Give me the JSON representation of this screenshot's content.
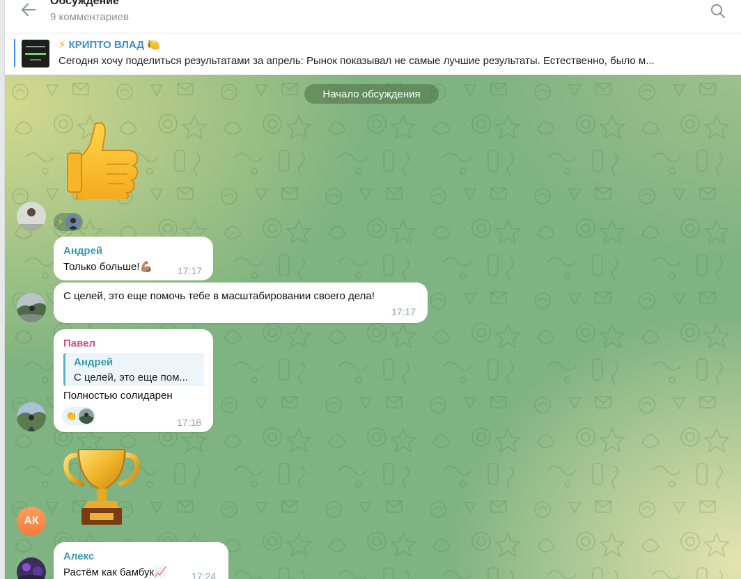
{
  "header": {
    "title": "Обсуждение",
    "subtitle": "9 комментариев"
  },
  "pinned_post": {
    "channel_name": "КРИПТО ВЛАД",
    "name_prefix_emoji": "⚡",
    "name_suffix_emoji": "🍋",
    "preview_text": "Сегодня хочу поделиться результатами за апрель:   Рынок показывал не самые лучшие результаты. Естественно, было м..."
  },
  "chat": {
    "date_separator": "Начало обсуждения",
    "messages": [
      {
        "type": "sticker",
        "sticker": "thumbs-up",
        "reactions": [
          {
            "emoji": "⚡",
            "count_avatars": 1
          }
        ]
      },
      {
        "type": "text",
        "sender": "Андрей",
        "sender_color": "#3a9ab0",
        "text": "Только больше!💪🏽",
        "time": "17:17"
      },
      {
        "type": "text",
        "sender": "",
        "text": "С целей, это еще помочь тебе в масштабировании своего дела!",
        "time": "17:17"
      },
      {
        "type": "reply",
        "sender": "Павел",
        "sender_color": "#d04f8a",
        "reply_to_sender": "Андрей",
        "reply_to_text": "С целей, это еще пом...",
        "text": "Полностью солидарен",
        "time": "17:18",
        "reactions": [
          {
            "emoji": "👏",
            "count_avatars": 1
          }
        ]
      },
      {
        "type": "sticker",
        "sticker": "trophy",
        "avatar_initials": "АК"
      },
      {
        "type": "text",
        "sender": "Алекс",
        "sender_color": "#3a9ab0",
        "text": "Растём как бамбук📈",
        "time": "17:24"
      }
    ]
  },
  "colors": {
    "accent": "#3390ec",
    "chat_bg": "#7fb381",
    "bubble_bg": "#ffffff",
    "time_color": "#8fa3b0"
  },
  "icons": [
    "back-arrow-icon",
    "search-icon",
    "thumbs-up-sticker",
    "trophy-sticker",
    "lightning-icon",
    "lemon-icon",
    "clap-icon"
  ]
}
